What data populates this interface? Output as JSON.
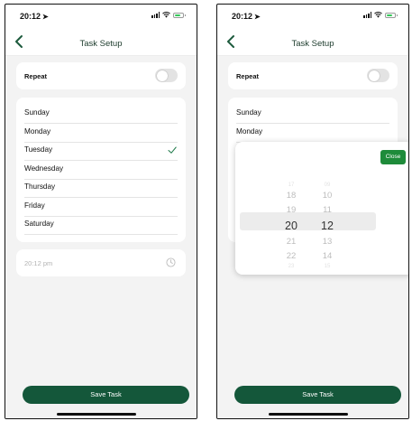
{
  "left_screen": {
    "status": {
      "time": "20:12"
    },
    "nav": {
      "title": "Task Setup"
    },
    "repeat": {
      "label": "Repeat",
      "enabled": false
    },
    "days": [
      {
        "label": "Sunday",
        "selected": false
      },
      {
        "label": "Monday",
        "selected": false
      },
      {
        "label": "Tuesday",
        "selected": true
      },
      {
        "label": "Wednesday",
        "selected": false
      },
      {
        "label": "Thursday",
        "selected": false
      },
      {
        "label": "Friday",
        "selected": false
      },
      {
        "label": "Saturday",
        "selected": false
      }
    ],
    "time_field": {
      "value": "20:12 pm"
    },
    "save_button": {
      "label": "Save Task"
    }
  },
  "right_screen": {
    "status": {
      "time": "20:12"
    },
    "nav": {
      "title": "Task Setup"
    },
    "repeat": {
      "label": "Repeat",
      "enabled": false
    },
    "days": [
      {
        "label": "Sunday"
      },
      {
        "label": "Monday"
      }
    ],
    "picker": {
      "close_label": "Close",
      "hours_above": [
        "18",
        "19"
      ],
      "hour_selected": "20",
      "hours_below": [
        "21",
        "22"
      ],
      "minutes_above": [
        "10",
        "11"
      ],
      "minute_selected": "12",
      "minutes_below": [
        "13",
        "14"
      ]
    },
    "save_button": {
      "label": "Save Task"
    }
  },
  "colors": {
    "primary_green": "#14573a",
    "close_button_green": "#1e8b3a",
    "check_green": "#1f7a4a",
    "background_gray": "#f3f3f3"
  }
}
